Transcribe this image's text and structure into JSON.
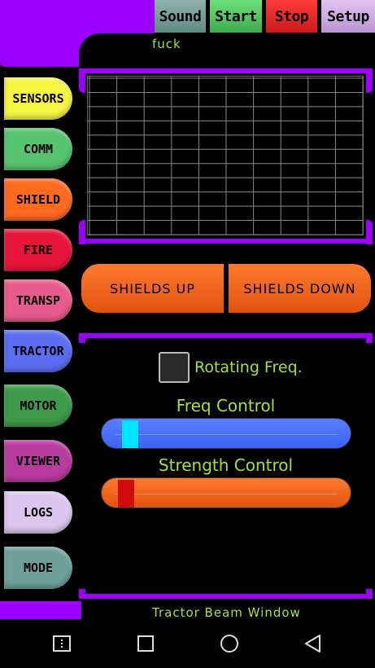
{
  "toolbar": {
    "sound": "Sound",
    "start": "Start",
    "stop": "Stop",
    "setup": "Setup"
  },
  "user_label": "fuck",
  "sidebar": {
    "items": [
      {
        "label": "SENSORS",
        "color": "#f5f542"
      },
      {
        "label": "COMM",
        "color": "#56c470"
      },
      {
        "label": "SHIELD",
        "color": "#ff6a1f"
      },
      {
        "label": "FIRE",
        "color": "#e8153a"
      },
      {
        "label": "TRANSP",
        "color": "#e85b8e"
      },
      {
        "label": "TRACTOR",
        "color": "#5b6df0"
      },
      {
        "label": "MOTOR",
        "color": "#3f9a4a"
      },
      {
        "label": "VIEWER",
        "color": "#b83ca0"
      },
      {
        "label": "LOGS",
        "color": "#dcc6ef"
      },
      {
        "label": "MODE",
        "color": "#6fa09a"
      }
    ]
  },
  "shields": {
    "up_label": "SHIELDS UP",
    "down_label": "SHIELDS DOWN"
  },
  "tractor": {
    "rotating_label": "Rotating Freq.",
    "rotating_checked": false,
    "freq_label": "Freq Control",
    "freq_value": 0.05,
    "strength_label": "Strength Control",
    "strength_value": 0.03
  },
  "footer_label": "Tractor Beam Window",
  "nav": {
    "recent_icon": "recent-apps-icon",
    "home_icon": "home-icon",
    "back_icon": "back-icon"
  },
  "colors": {
    "accent_purple": "#9b00ff",
    "text_green": "#a6e23a"
  }
}
